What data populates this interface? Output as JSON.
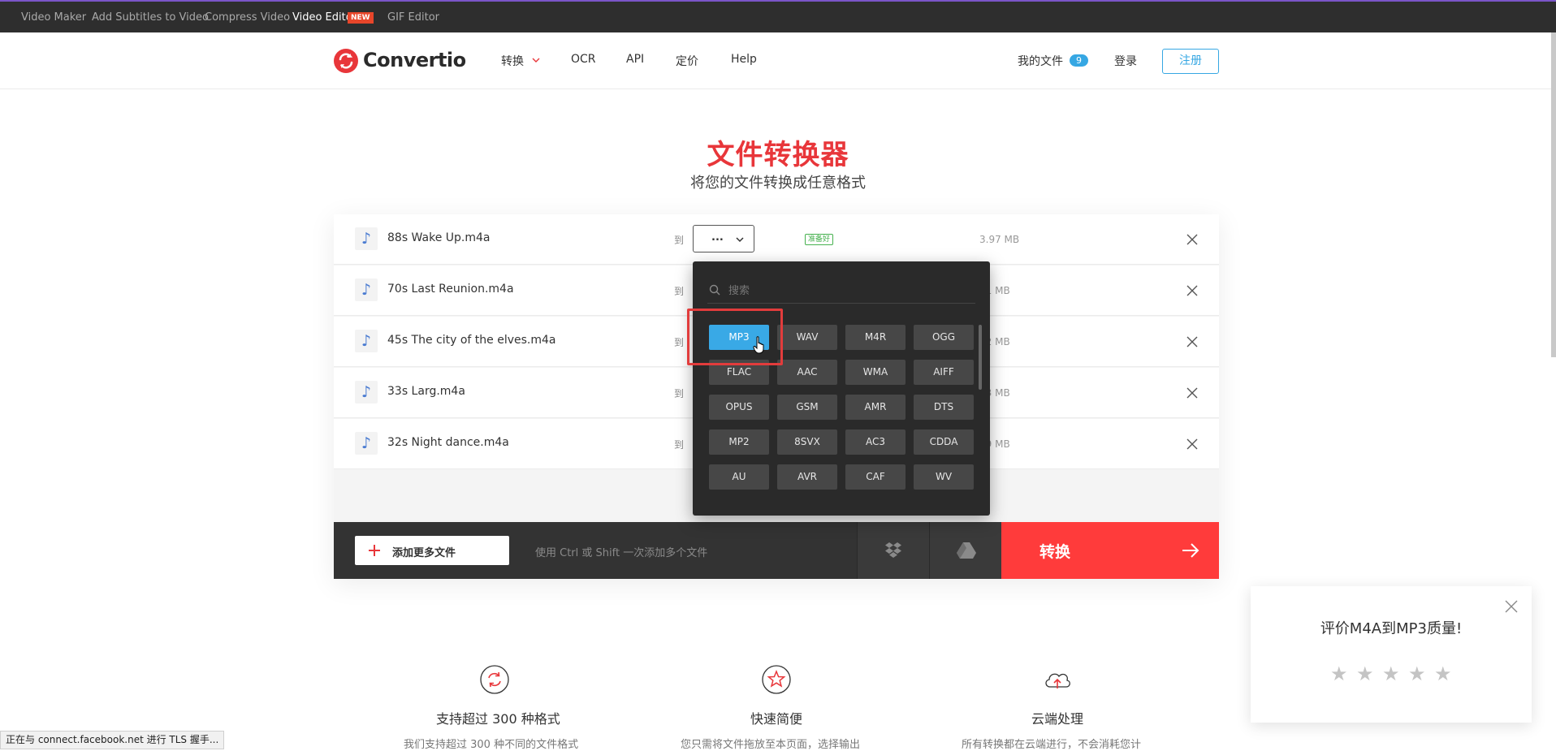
{
  "topbar": {
    "links": [
      {
        "label": "Video Maker"
      },
      {
        "label": "Add Subtitles to Video"
      },
      {
        "label": "Compress Video"
      },
      {
        "label": "Video Editor"
      },
      {
        "label": "GIF Editor"
      }
    ],
    "new_badge": "NEW"
  },
  "header": {
    "logo_text": "Convertio",
    "nav": [
      "转换",
      "OCR",
      "API",
      "定价",
      "Help"
    ],
    "my_files": "我的文件",
    "files_count": "9",
    "login": "登录",
    "signup": "注册"
  },
  "hero": {
    "title": "文件转换器",
    "subtitle": "将您的文件转换成任意格式"
  },
  "files": [
    {
      "name": "88s Wake Up.m4a",
      "to": "到",
      "size": "3.97 MB",
      "status": "准备好"
    },
    {
      "name": "70s Last Reunion.m4a",
      "to": "到",
      "size": "21 MB"
    },
    {
      "name": "45s The city of the elves.m4a",
      "to": "到",
      "size": "32 MB"
    },
    {
      "name": "33s Larg.m4a",
      "to": "到",
      "size": "33 MB"
    },
    {
      "name": "32s Night dance.m4a",
      "to": "到",
      "size": "79 MB"
    }
  ],
  "format_select": {
    "value": "..."
  },
  "dropdown": {
    "search_placeholder": "搜索",
    "formats": [
      "MP3",
      "WAV",
      "M4R",
      "OGG",
      "FLAC",
      "AAC",
      "WMA",
      "AIFF",
      "OPUS",
      "GSM",
      "AMR",
      "DTS",
      "MP2",
      "8SVX",
      "AC3",
      "CDDA",
      "AU",
      "AVR",
      "CAF",
      "WV"
    ],
    "active": "MP3"
  },
  "action_bar": {
    "add_more": "添加更多文件",
    "hint": "使用 Ctrl 或 Shift 一次添加多个文件",
    "convert": "转换"
  },
  "rating": {
    "title": "评价M4A到MP3质量!",
    "stars": 5
  },
  "features": [
    {
      "title": "支持超过 300 种格式",
      "desc": "我们支持超过 300 种不同的文件格式"
    },
    {
      "title": "快速简便",
      "desc": "您只需将文件拖放至本页面，选择输出"
    },
    {
      "title": "云端处理",
      "desc": "所有转换都在云端进行，不会消耗您计"
    }
  ],
  "status_bar": "正在与 connect.facebook.net 进行 TLS 握手..."
}
